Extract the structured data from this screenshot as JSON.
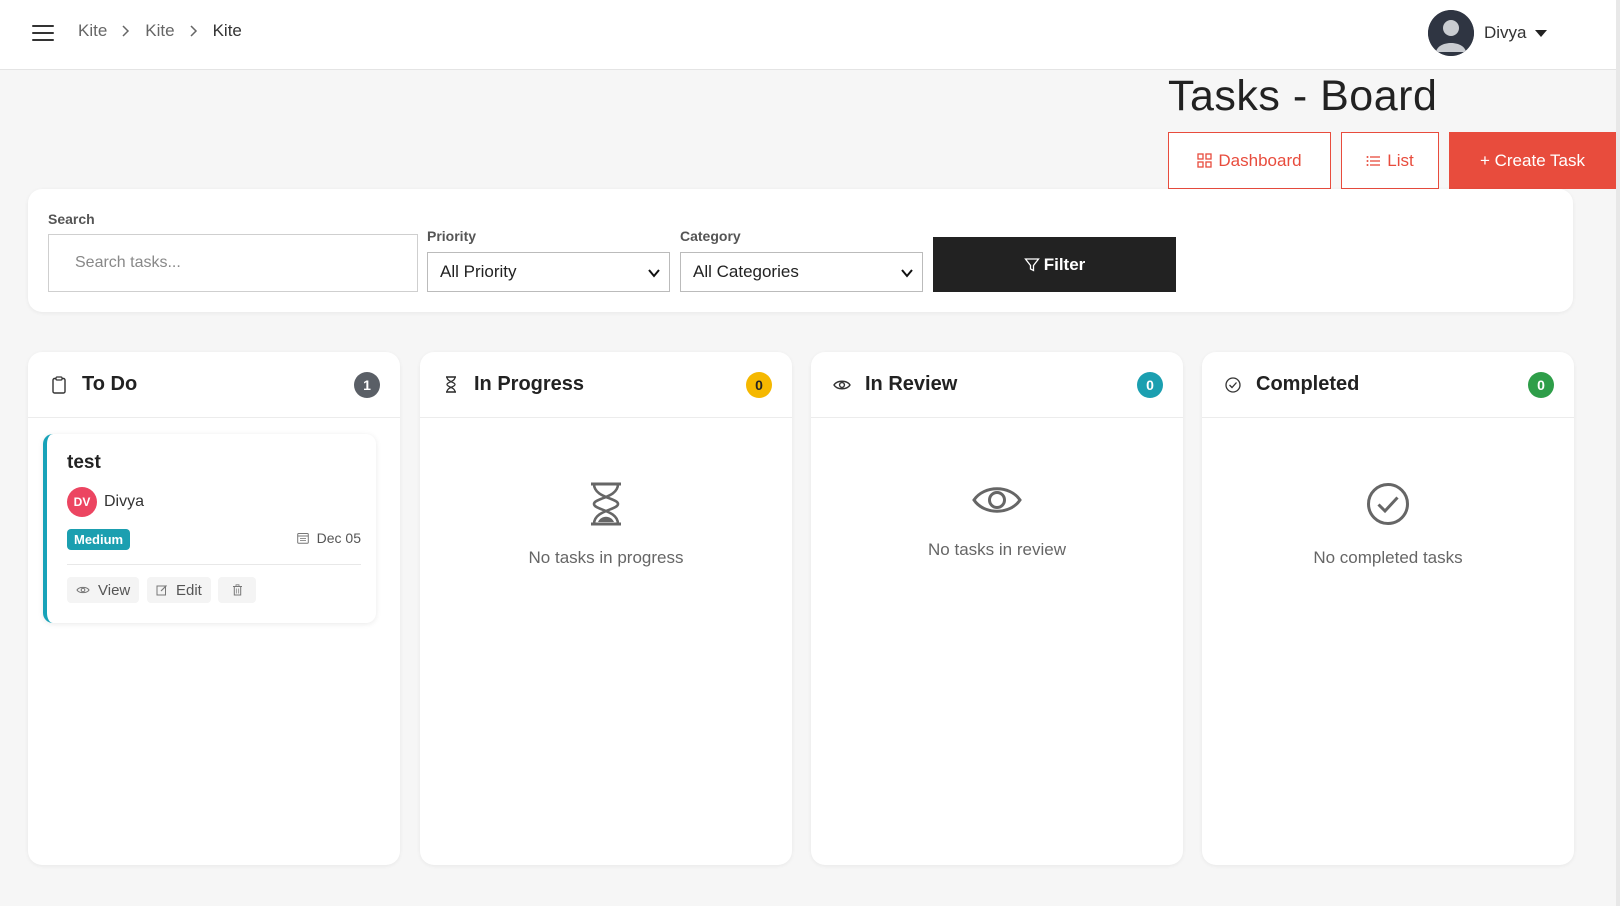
{
  "breadcrumb": [
    "Kite",
    "Kite",
    "Kite"
  ],
  "user": {
    "name": "Divya"
  },
  "page": {
    "title": "Tasks - Board"
  },
  "actions": {
    "dashboard": "Dashboard",
    "list": "List",
    "create": "+ Create Task"
  },
  "filters": {
    "search_label": "Search",
    "search_placeholder": "Search tasks...",
    "priority_label": "Priority",
    "priority_value": "All Priority",
    "category_label": "Category",
    "category_value": "All Categories",
    "filter_button": "Filter"
  },
  "columns": [
    {
      "title": "To Do",
      "count": "1",
      "icon": "clipboard-icon",
      "badge_color": "#5a5f66"
    },
    {
      "title": "In Progress",
      "count": "0",
      "icon": "hourglass-icon",
      "badge_color": "#f5b800",
      "empty_text": "No tasks in progress"
    },
    {
      "title": "In Review",
      "count": "0",
      "icon": "eye-icon",
      "badge_color": "#1b9fb0",
      "empty_text": "No tasks in review"
    },
    {
      "title": "Completed",
      "count": "0",
      "icon": "check-circle-icon",
      "badge_color": "#2e9e49",
      "empty_text": "No completed tasks"
    }
  ],
  "task": {
    "title": "test",
    "assignee_initials": "DV",
    "assignee_name": "Divya",
    "priority": "Medium",
    "due": "Dec 05",
    "view_label": "View",
    "edit_label": "Edit"
  },
  "colors": {
    "accent": "#e84c3d",
    "dark": "#222222"
  }
}
